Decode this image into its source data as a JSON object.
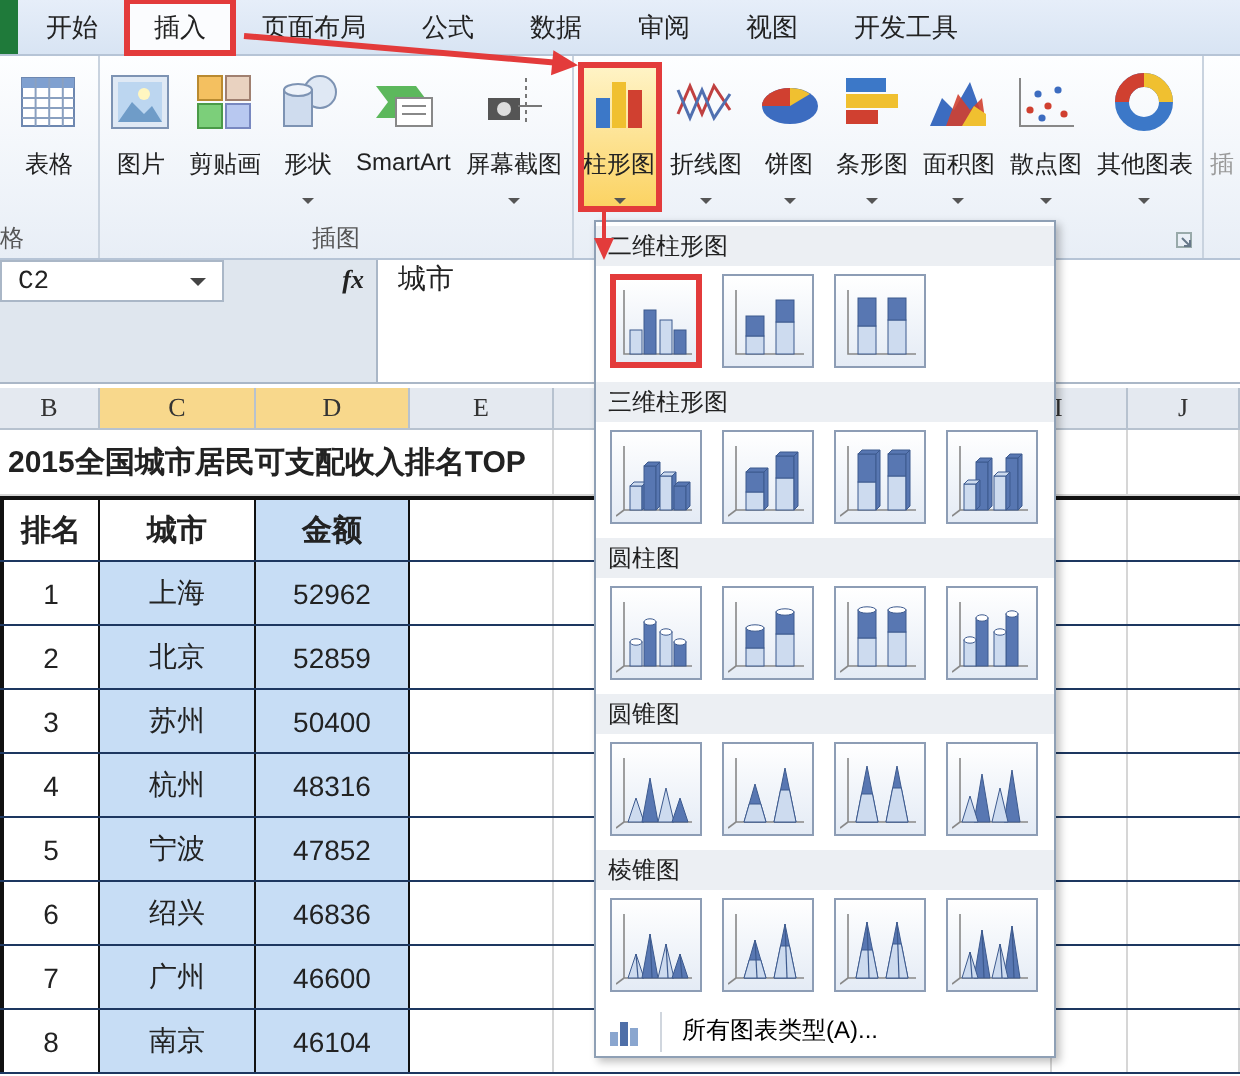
{
  "tabs": [
    {
      "label": "开始",
      "selected": false,
      "marked": false
    },
    {
      "label": "插入",
      "selected": true,
      "marked": true
    },
    {
      "label": "页面布局",
      "selected": false,
      "marked": false
    },
    {
      "label": "公式",
      "selected": false,
      "marked": false
    },
    {
      "label": "数据",
      "selected": false,
      "marked": false
    },
    {
      "label": "审阅",
      "selected": false,
      "marked": false
    },
    {
      "label": "视图",
      "selected": false,
      "marked": false
    },
    {
      "label": "开发工具",
      "selected": false,
      "marked": false
    }
  ],
  "ribbon": {
    "groups": [
      {
        "label": "格",
        "buttons": [
          {
            "label": "表格",
            "menu": false
          }
        ]
      },
      {
        "label": "插图",
        "buttons": [
          {
            "label": "图片",
            "menu": false
          },
          {
            "label": "剪贴画",
            "menu": false
          },
          {
            "label": "形状",
            "menu": true
          },
          {
            "label": "SmartArt",
            "menu": false
          },
          {
            "label": "屏幕截图",
            "menu": true
          }
        ]
      },
      {
        "launcher": true,
        "buttons": [
          {
            "label": "柱形图",
            "menu": true,
            "selected": true,
            "marked": true
          },
          {
            "label": "折线图",
            "menu": true,
            "selected": false,
            "marked": false
          },
          {
            "label": "饼图",
            "menu": true,
            "selected": false,
            "marked": false
          },
          {
            "label": "条形图",
            "menu": true,
            "selected": false,
            "marked": false
          },
          {
            "label": "面积图",
            "menu": true,
            "selected": false,
            "marked": false
          },
          {
            "label": "散点图",
            "menu": true,
            "selected": false,
            "marked": false
          },
          {
            "label": "其他图表",
            "menu": true,
            "selected": false,
            "marked": false
          }
        ]
      },
      {
        "buttons": [
          {
            "label": "插",
            "menu": false
          }
        ]
      }
    ]
  },
  "formula_bar": {
    "name_box": "C2",
    "function_label": "fx",
    "formula": "城市"
  },
  "columns": [
    {
      "label": "B",
      "selected": false
    },
    {
      "label": "C",
      "selected": true
    },
    {
      "label": "D",
      "selected": true
    },
    {
      "label": "E",
      "selected": false
    },
    {
      "label": "I",
      "selected": false
    },
    {
      "label": "J",
      "selected": false
    }
  ],
  "sheet": {
    "title": "2015全国城市居民可支配收入排名TOP",
    "table": {
      "columns": [
        {
          "label": "排名",
          "header_selected": false,
          "cells_selected": false
        },
        {
          "label": "城市",
          "header_selected": false,
          "cells_selected": true
        },
        {
          "label": "金额",
          "header_selected": true,
          "cells_selected": true
        }
      ],
      "rows": [
        [
          "1",
          "上海",
          "52962"
        ],
        [
          "2",
          "北京",
          "52859"
        ],
        [
          "3",
          "苏州",
          "50400"
        ],
        [
          "4",
          "杭州",
          "48316"
        ],
        [
          "5",
          "宁波",
          "47852"
        ],
        [
          "6",
          "绍兴",
          "46836"
        ],
        [
          "7",
          "广州",
          "46600"
        ],
        [
          "8",
          "南京",
          "46104"
        ]
      ]
    }
  },
  "chart_menu": {
    "sections": [
      {
        "title": "二维柱形图",
        "kind": "column2d",
        "items": [
          {
            "marked": true
          },
          {
            "marked": false
          },
          {
            "marked": false
          }
        ]
      },
      {
        "title": "三维柱形图",
        "kind": "column3d",
        "items": [
          {
            "marked": false
          },
          {
            "marked": false
          },
          {
            "marked": false
          },
          {
            "marked": false
          }
        ]
      },
      {
        "title": "圆柱图",
        "kind": "cylinder",
        "items": [
          {
            "marked": false
          },
          {
            "marked": false
          },
          {
            "marked": false
          },
          {
            "marked": false
          }
        ]
      },
      {
        "title": "圆锥图",
        "kind": "cone",
        "items": [
          {
            "marked": false
          },
          {
            "marked": false
          },
          {
            "marked": false
          },
          {
            "marked": false
          }
        ]
      },
      {
        "title": "棱锥图",
        "kind": "pyramid",
        "items": [
          {
            "marked": false
          },
          {
            "marked": false
          },
          {
            "marked": false
          },
          {
            "marked": false
          }
        ]
      }
    ],
    "footer": "所有图表类型(A)..."
  }
}
